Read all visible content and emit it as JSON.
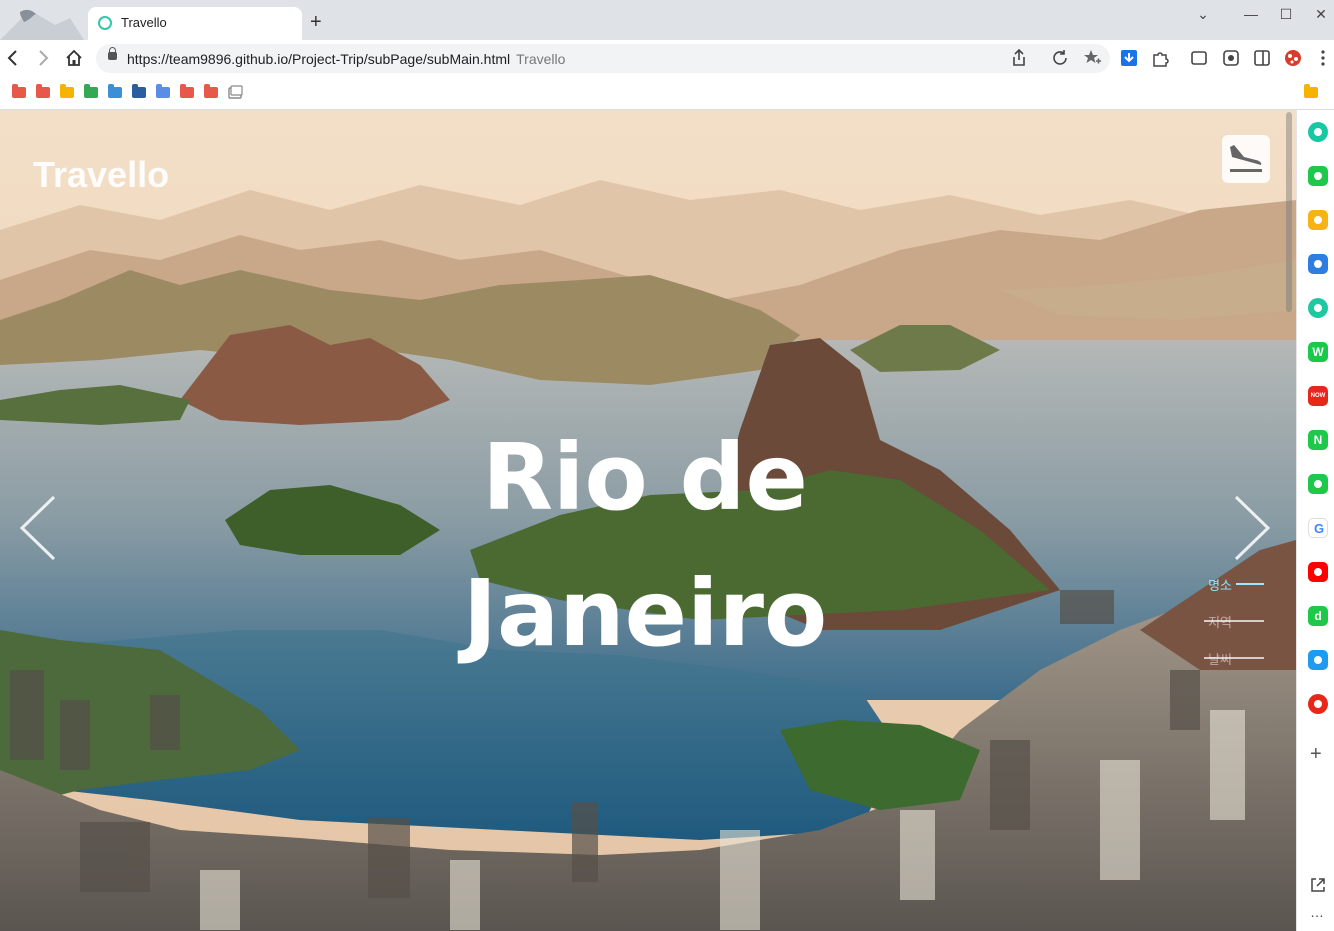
{
  "browser": {
    "tab": {
      "title": "Travello"
    },
    "new_tab_label": "+",
    "url": "https://team9896.github.io/Project-Trip/subPage/subMain.html",
    "url_page_title": "Travello",
    "window_controls": {
      "chevron": "⌄",
      "minimize": "—",
      "maximize": "☐",
      "close": "✕"
    }
  },
  "bookmarks": {
    "folders": [
      "#e8584a",
      "#e8584a",
      "#f4b400",
      "#35a853",
      "#3a8fd6",
      "#2a5e9e",
      "#5b8de6",
      "#e8584a",
      "#e8584a"
    ],
    "right_folder": "#f4b400"
  },
  "page": {
    "logo": "Travello",
    "hero_title_line1": "Rio de",
    "hero_title_line2": "Janeiro",
    "side_menu": [
      {
        "label": "명소",
        "active": true
      },
      {
        "label": "지역",
        "active": false
      },
      {
        "label": "날씨",
        "active": false
      }
    ]
  },
  "sidebar": {
    "icons": [
      {
        "name": "circle-app-icon",
        "color": "#17c8a4"
      },
      {
        "name": "bell-app-icon",
        "color": "#1ec84a"
      },
      {
        "name": "star-app-icon",
        "color": "#f6b313"
      },
      {
        "name": "refresh-app-icon",
        "color": "#2e7de0"
      },
      {
        "name": "play-app-icon",
        "color": "#1ec8a0"
      },
      {
        "name": "webtoon-app-icon",
        "color": "#19c94c",
        "glyph": "W"
      },
      {
        "name": "now-app-icon",
        "color": "#e8271b",
        "glyph": "NOW"
      },
      {
        "name": "naver-app-icon",
        "color": "#1ec84a",
        "glyph": "N"
      },
      {
        "name": "list-app-icon",
        "color": "#1ec84a"
      },
      {
        "name": "google-app-icon",
        "color": "#ffffff",
        "glyph": "G"
      },
      {
        "name": "youtube-app-icon",
        "color": "#ff0000"
      },
      {
        "name": "dict-app-icon",
        "color": "#1ec84a",
        "glyph": "d"
      },
      {
        "name": "twitter-app-icon",
        "color": "#1d9bf0"
      },
      {
        "name": "record-app-icon",
        "color": "#e8271b"
      }
    ],
    "add_label": "+",
    "more_label": "…"
  }
}
